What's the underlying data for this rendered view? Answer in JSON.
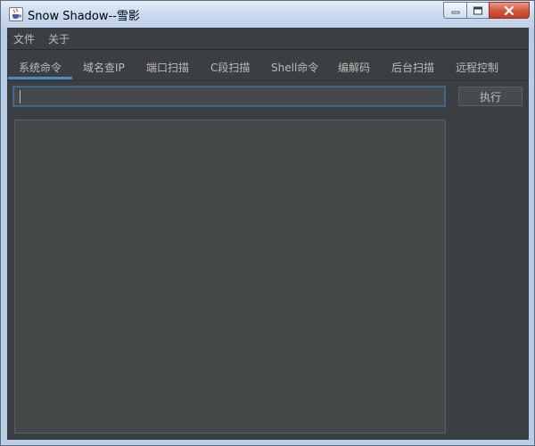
{
  "window": {
    "title": "Snow Shadow--雪影",
    "app_icon": "java-cup-icon",
    "controls": [
      "minimize-icon",
      "maximize-icon",
      "close-icon"
    ]
  },
  "menubar": {
    "items": [
      {
        "label": "文件"
      },
      {
        "label": "关于"
      }
    ]
  },
  "tabs": {
    "active_index": 0,
    "items": [
      {
        "label": "系统命令"
      },
      {
        "label": "域名查IP"
      },
      {
        "label": "端口扫描"
      },
      {
        "label": "C段扫描"
      },
      {
        "label": "Shell命令"
      },
      {
        "label": "编解码"
      },
      {
        "label": "后台扫描"
      },
      {
        "label": "远程控制"
      }
    ]
  },
  "command": {
    "value": "",
    "execute_label": "执行"
  },
  "output": {
    "value": ""
  },
  "colors": {
    "background": "#3c3f41",
    "field": "#45494a",
    "text": "#bbbbbb",
    "accent": "#4a88c7"
  }
}
